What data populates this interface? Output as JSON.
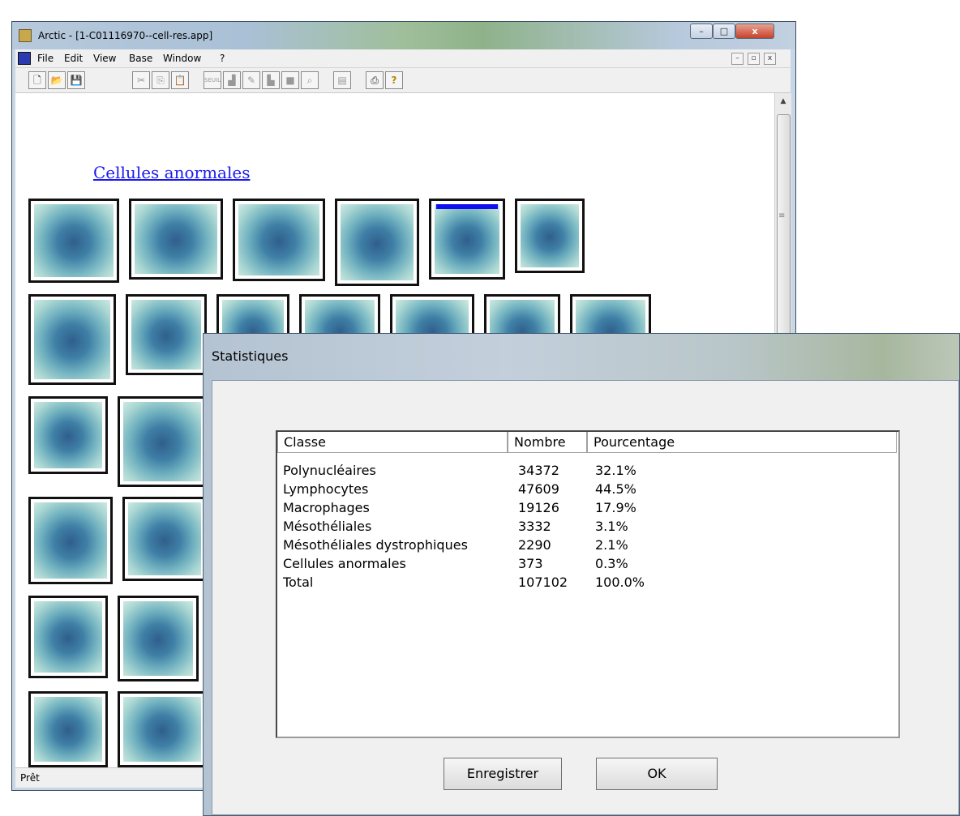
{
  "main_window": {
    "title": "Arctic - [1-C01116970--cell-res.app]",
    "caption_buttons": {
      "minimize": "–",
      "maximize": "□",
      "close": "x"
    },
    "menu": [
      "File",
      "Edit",
      "View",
      "Base",
      "Window",
      "?"
    ],
    "mdi_buttons": {
      "minimize": "–",
      "restore": "▫",
      "close": "x"
    },
    "toolbar": [
      {
        "icon": "new-icon",
        "glyph": "🗋"
      },
      {
        "icon": "open-icon",
        "glyph": "📂"
      },
      {
        "icon": "save-icon",
        "glyph": "💾"
      },
      {
        "icon": "cut-icon",
        "glyph": "✂"
      },
      {
        "icon": "copy-icon",
        "glyph": "⎘"
      },
      {
        "icon": "paste-icon",
        "glyph": "📋"
      },
      {
        "icon": "threshold-icon",
        "glyph": "SEUIL"
      },
      {
        "icon": "histogram-icon",
        "glyph": "▟"
      },
      {
        "icon": "pencil-icon",
        "glyph": "✎"
      },
      {
        "icon": "profile-icon",
        "glyph": "▙"
      },
      {
        "icon": "rectangle-icon",
        "glyph": "■"
      },
      {
        "icon": "zoom-icon",
        "glyph": "⌕"
      },
      {
        "icon": "document-icon",
        "glyph": "▤"
      },
      {
        "icon": "print-icon",
        "glyph": "⎙"
      },
      {
        "icon": "help-icon",
        "glyph": "?"
      }
    ],
    "section_title": "Cellules anormales",
    "status": "Prêt"
  },
  "dialog": {
    "title": "Statistiques",
    "columns": [
      "Classe",
      "Nombre",
      "Pourcentage"
    ],
    "rows": [
      {
        "classe": "Polynucléaires",
        "nombre": "34372",
        "pourcentage": "32.1%"
      },
      {
        "classe": "Lymphocytes",
        "nombre": "47609",
        "pourcentage": "44.5%"
      },
      {
        "classe": "Macrophages",
        "nombre": "19126",
        "pourcentage": "17.9%"
      },
      {
        "classe": "Mésothéliales",
        "nombre": "3332",
        "pourcentage": "3.1%"
      },
      {
        "classe": "Mésothéliales dystrophiques",
        "nombre": "2290",
        "pourcentage": "2.1%"
      },
      {
        "classe": "Cellules anormales",
        "nombre": "373",
        "pourcentage": "0.3%"
      },
      {
        "classe": "Total",
        "nombre": "107102",
        "pourcentage": "100.0%"
      }
    ],
    "buttons": {
      "save": "Enregistrer",
      "ok": "OK"
    }
  }
}
